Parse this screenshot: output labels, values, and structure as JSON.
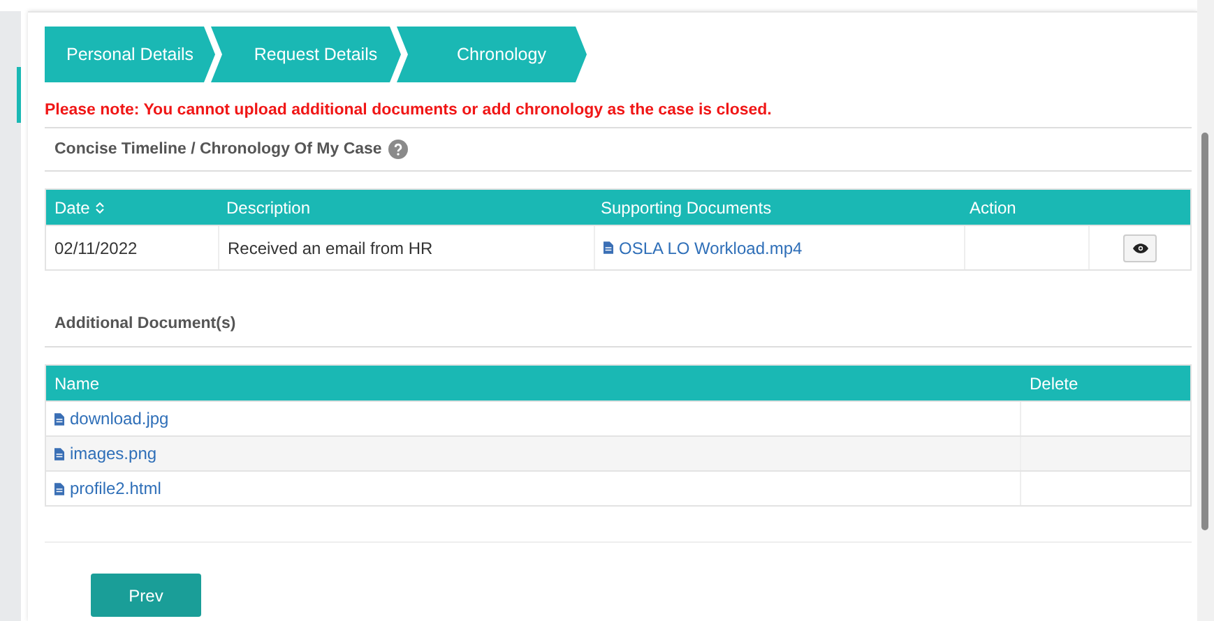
{
  "steps": [
    {
      "label": "Personal Details"
    },
    {
      "label": "Request Details"
    },
    {
      "label": "Chronology"
    }
  ],
  "notice": "Please note: You cannot upload additional documents or add chronology as the case is closed.",
  "timeline": {
    "title": "Concise Timeline / Chronology Of My Case",
    "columns": [
      "Date",
      "Description",
      "Supporting Documents",
      "Action"
    ],
    "rows": [
      {
        "date": "02/11/2022",
        "description": "Received an email from HR",
        "document": "OSLA LO Workload.mp4"
      }
    ]
  },
  "additional": {
    "title": "Additional Document(s)",
    "columns": [
      "Name",
      "Delete"
    ],
    "rows": [
      {
        "name": "download.jpg"
      },
      {
        "name": "images.png"
      },
      {
        "name": "profile2.html"
      }
    ]
  },
  "prev_button": "Prev"
}
